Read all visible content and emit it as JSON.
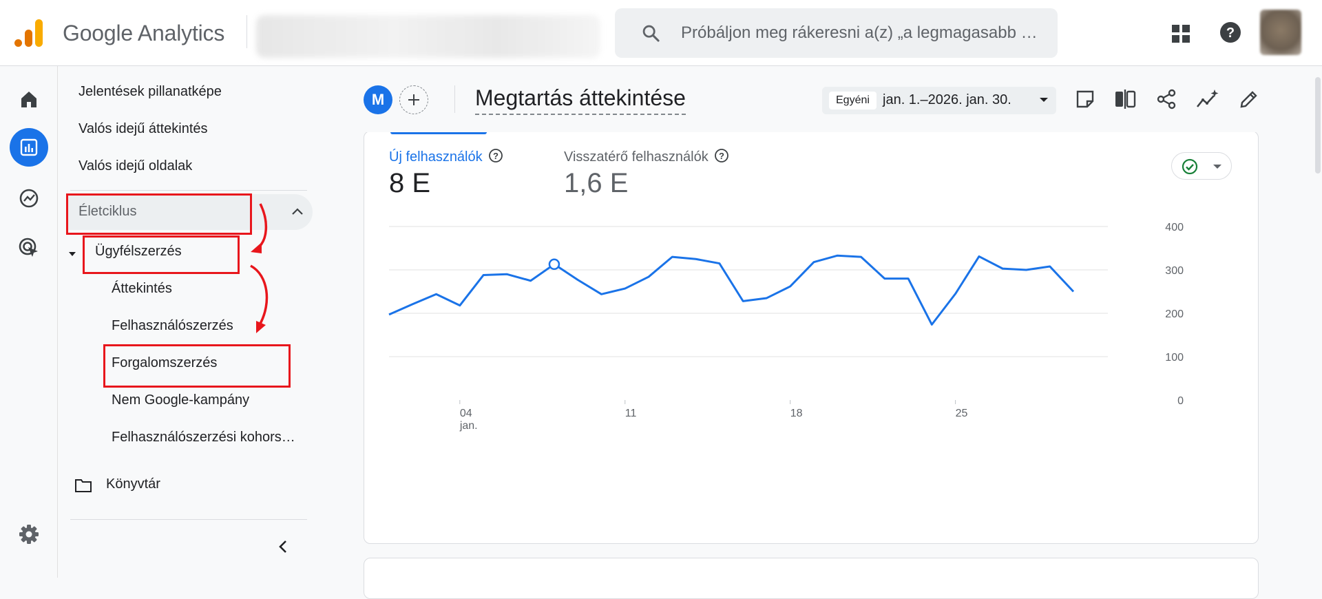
{
  "topbar": {
    "brand": "Google Analytics",
    "search_placeholder": "Próbáljon meg rákeresni a(z) „a legmagasabb …"
  },
  "icons": {
    "apps": "apps-grid-icon",
    "help": "help-circle-icon",
    "home": "home-icon",
    "reports": "bar-chart-icon",
    "explore": "explore-icon",
    "advertising": "target-cursor-icon",
    "settings": "gear-icon"
  },
  "nav": {
    "items": [
      {
        "label": "Jelentések pillanatképe"
      },
      {
        "label": "Valós idejű áttekintés"
      },
      {
        "label": "Valós idejű oldalak"
      }
    ],
    "section": "Életciklus",
    "group": "Ügyfélszerzés",
    "subitems": [
      {
        "label": "Áttekintés"
      },
      {
        "label": "Felhasználószerzés"
      },
      {
        "label": "Forgalomszerzés"
      },
      {
        "label": "Nem Google-kampány"
      },
      {
        "label": "Felhasználószerzési kohors…"
      }
    ],
    "library": "Könyvtár"
  },
  "header": {
    "comparison_avatar": "M",
    "title": "Megtartás áttekintése",
    "date_tag": "Egyéni",
    "date_range": "jan. 1.–2026. jan. 30."
  },
  "colors": {
    "accent": "#1a73e8",
    "annotation_red": "#e8161c",
    "status_green": "#188038"
  },
  "metrics": [
    {
      "label": "Új felhasználók",
      "value": "8 E",
      "active": true
    },
    {
      "label": "Visszatérő felhasználók",
      "value": "1,6 E",
      "active": false
    }
  ],
  "chart_data": {
    "type": "line",
    "x_tick_labels": [
      "04",
      "11",
      "18",
      "25"
    ],
    "x_tick_sublabel": "jan.",
    "y_tick_labels": [
      "0",
      "100",
      "200",
      "300",
      "400"
    ],
    "ylim": [
      0,
      400
    ],
    "grid": true,
    "series": [
      {
        "x": [
          1,
          2,
          3,
          4,
          5,
          6,
          7,
          8,
          9,
          10,
          11,
          12,
          13,
          14,
          15,
          16,
          17,
          18,
          19,
          20,
          21,
          22,
          23,
          24,
          25,
          26,
          27,
          28,
          29,
          30
        ],
        "values": [
          197,
          221,
          244,
          218,
          288,
          290,
          275,
          313,
          277,
          244,
          257,
          284,
          330,
          325,
          315,
          228,
          235,
          262,
          318,
          333,
          330,
          280,
          280,
          174,
          245,
          331,
          303,
          300,
          308,
          250
        ]
      }
    ],
    "highlight_x": 8
  }
}
